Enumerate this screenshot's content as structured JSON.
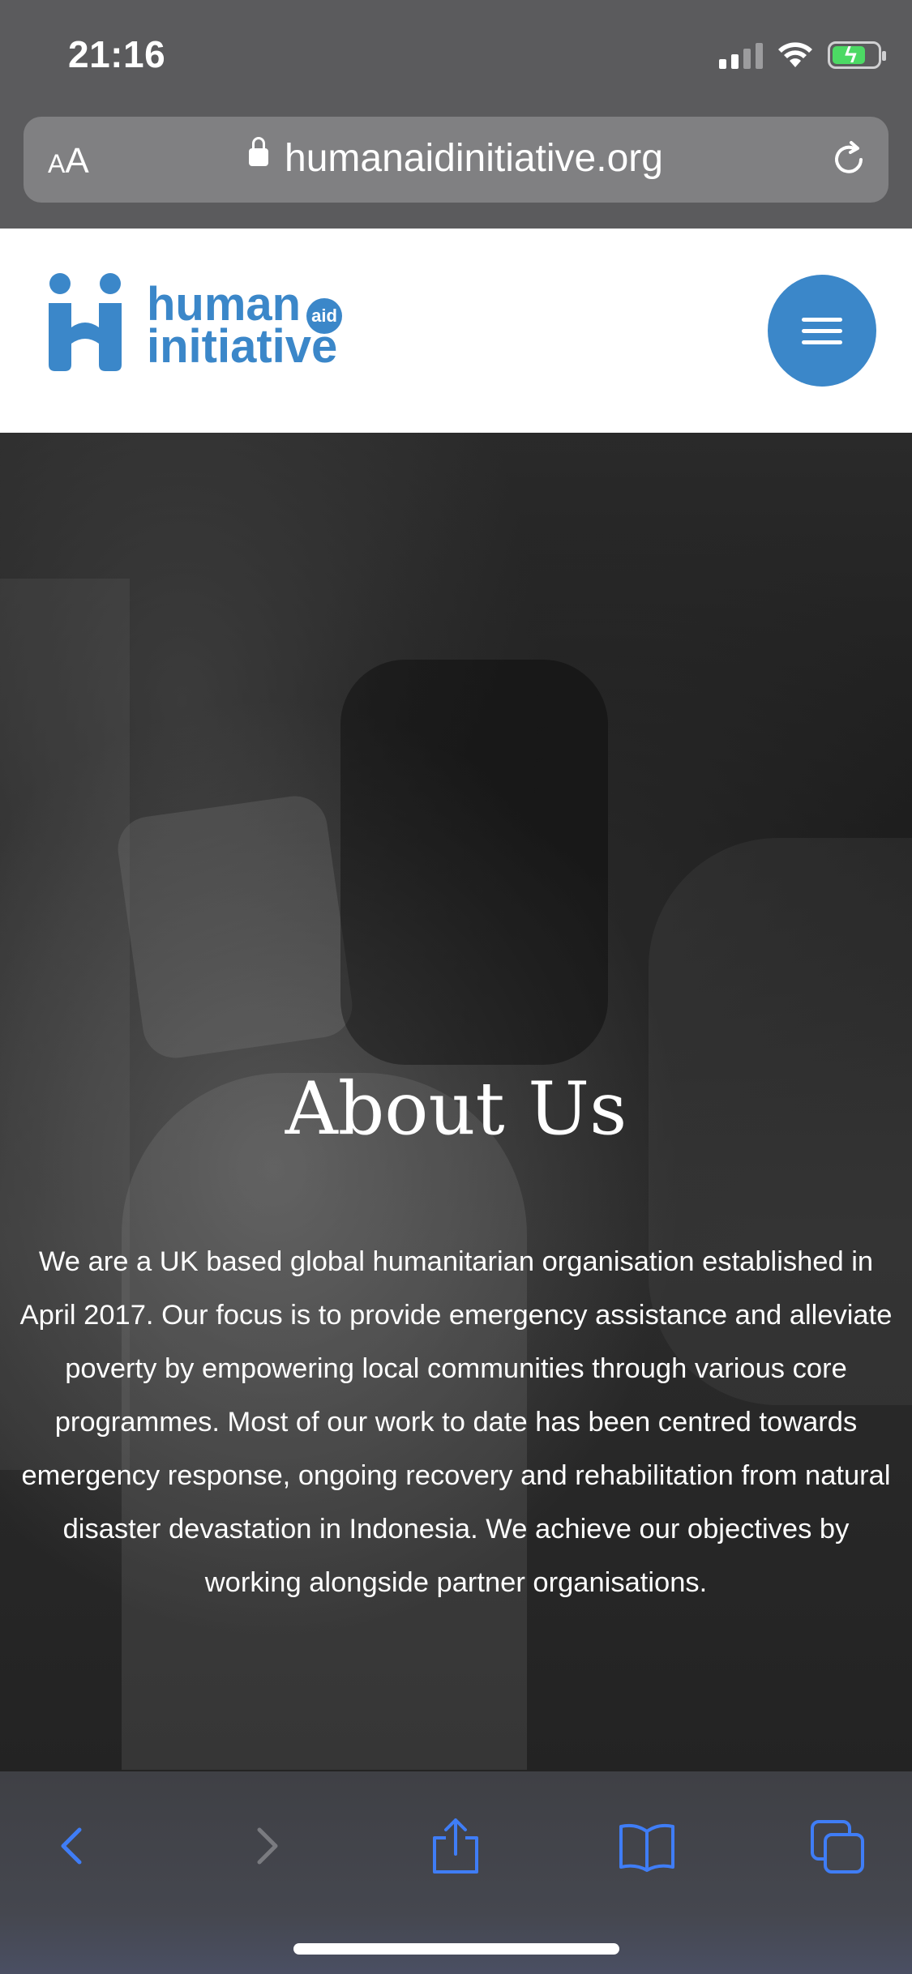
{
  "status_bar": {
    "time": "21:16"
  },
  "browser": {
    "text_size_label": "AA",
    "url": "humanaidinitiative.org"
  },
  "site": {
    "logo": {
      "line1": "human",
      "line2": "initiative",
      "badge": "aid"
    }
  },
  "hero": {
    "title": "About Us",
    "body": "We are a UK based global humanitarian organisation established in April 2017. Our focus is to provide emergency assistance and alleviate poverty by empowering local communities through various core programmes. Most of our work to date has been centred towards emergency response, ongoing recovery and rehabilitation from natural disaster devastation in Indonesia. We achieve our objectives by working alongside partner organisations."
  },
  "colors": {
    "brand_blue": "#3b87c9",
    "toolbar_icon_blue": "#3f7df6"
  }
}
